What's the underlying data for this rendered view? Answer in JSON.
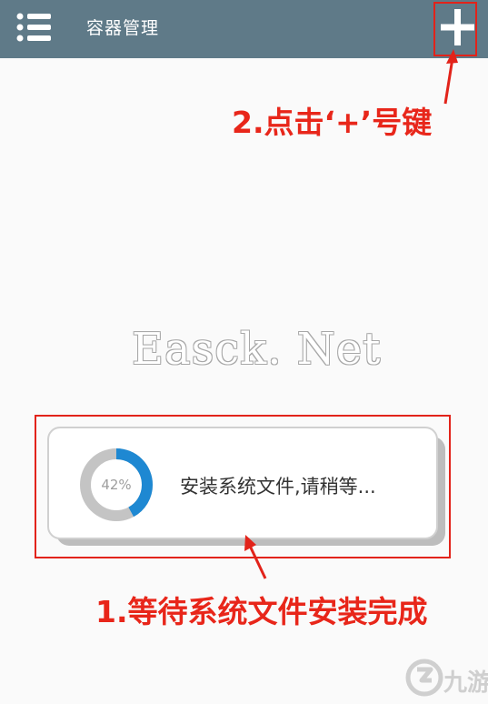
{
  "appbar": {
    "title": "容器管理",
    "color": "#5f7a88",
    "menu_icon": "menu-icon",
    "add_icon": "plus-icon"
  },
  "dialog": {
    "progress": {
      "value": 42,
      "label": "42%",
      "color": "#1e88d2",
      "track_color": "#c4c4c4"
    },
    "message": "安装系统文件,请稍等..."
  },
  "annotations": {
    "step2": "2.点击‘+’号键",
    "step1": "1.等待系统文件安装完成",
    "color": "#e8261a"
  },
  "watermark": "Easck. Net",
  "logo": {
    "text": "九游"
  }
}
